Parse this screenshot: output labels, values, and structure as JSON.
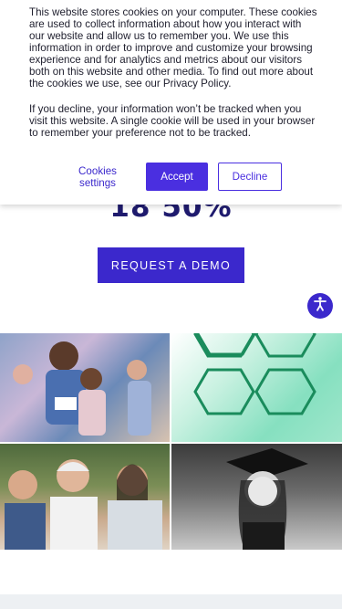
{
  "headline": "18 50%",
  "demo_button": "REQUEST A DEMO",
  "cookie_banner": {
    "paragraph1": "This website stores cookies on your computer. These cookies are used to collect information about how you interact with our website and allow us to remember you. We use this information in order to improve and customize your browsing experience and for analytics and metrics about our visitors both on this website and other media. To find out more about the cookies we use, see our Privacy Policy.",
    "paragraph2": "If you decline, your information won’t be tracked when you visit this website. A single cookie will be used in your browser to remember your preference not to be tracked.",
    "settings_label": "Cookies settings",
    "accept_label": "Accept",
    "decline_label": "Decline"
  },
  "colors": {
    "brand": "#3b28cc",
    "accent": "#4a2fe0",
    "headline": "#1f1b6e",
    "hex_pattern": "#1a8c5c"
  },
  "icons": {
    "accessibility": "accessibility-icon"
  },
  "images": [
    {
      "name": "color-run-photo"
    },
    {
      "name": "hexagon-pattern"
    },
    {
      "name": "diverse-people-photo"
    },
    {
      "name": "graduate-photo"
    }
  ]
}
